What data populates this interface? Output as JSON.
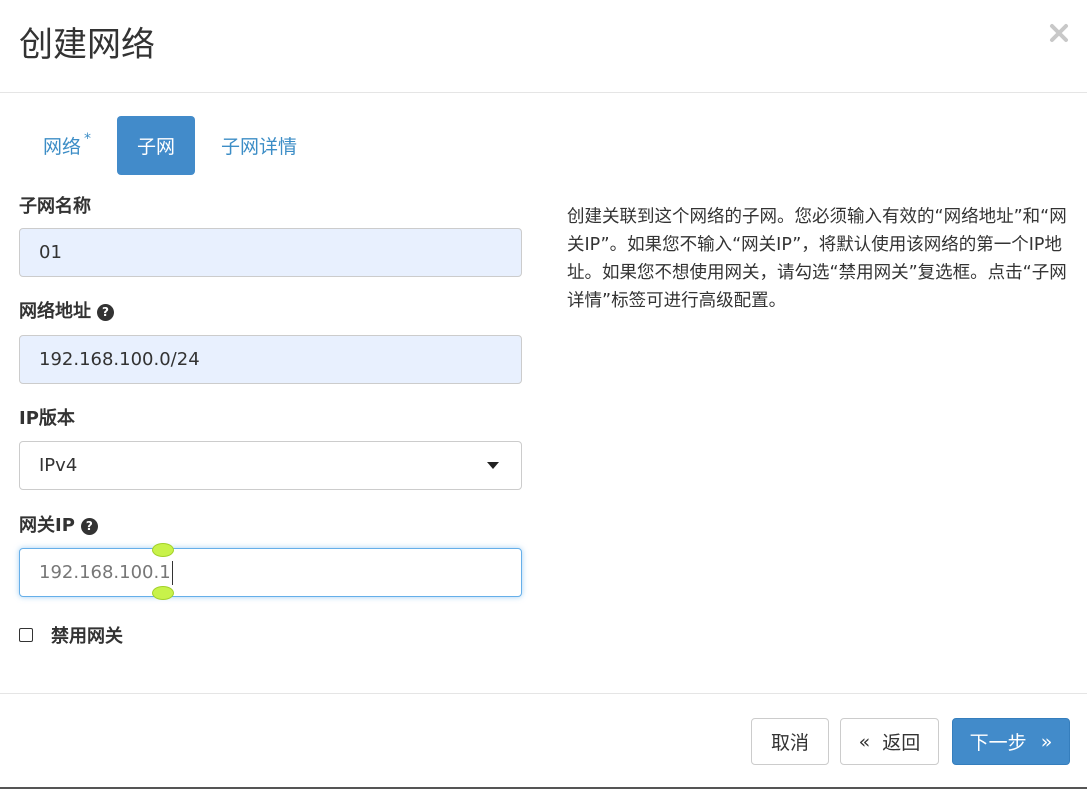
{
  "dialog": {
    "title": "创建网络",
    "close_icon": "close-icon"
  },
  "tabs": [
    {
      "label": "网络",
      "required_mark": "*",
      "active": false
    },
    {
      "label": "子网",
      "active": true
    },
    {
      "label": "子网详情",
      "active": false
    }
  ],
  "form": {
    "subnet_name": {
      "label": "子网名称",
      "value": "01"
    },
    "network_address": {
      "label": "网络地址",
      "help_icon": "?",
      "value": "192.168.100.0/24"
    },
    "ip_version": {
      "label": "IP版本",
      "selected": "IPv4"
    },
    "gateway_ip": {
      "label": "网关IP",
      "help_icon": "?",
      "value": "192.168.100.1"
    },
    "disable_gateway": {
      "label": "禁用网关",
      "checked": false
    }
  },
  "help_text": "创建关联到这个网络的子网。您必须输入有效的“网络地址”和“网关IP”。如果您不输入“网关IP”，将默认使用该网络的第一个IP地址。如果您不想使用网关，请勾选“禁用网关”复选框。点击“子网详情”标签可进行高级配置。",
  "footer": {
    "cancel_label": "取消",
    "back_icon": "«",
    "back_label": "返回",
    "next_label": "下一步",
    "next_icon": "»"
  },
  "colors": {
    "primary": "#428bca",
    "link": "#3c8dc6",
    "autofill_bg": "#e8f0fe",
    "focus_border": "#66afe9"
  }
}
